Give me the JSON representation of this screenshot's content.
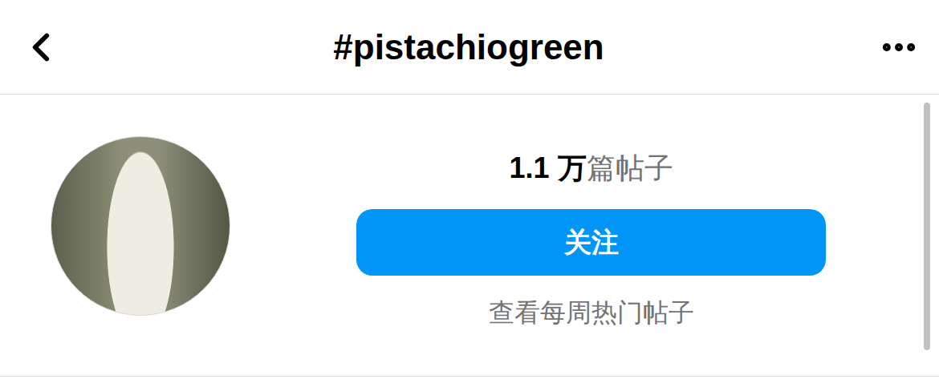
{
  "header": {
    "title": "#pistachiogreen"
  },
  "profile": {
    "post_count": "1.1 万",
    "post_label": "篇帖子",
    "follow_button": "关注",
    "weekly_link": "查看每周热门帖子"
  }
}
